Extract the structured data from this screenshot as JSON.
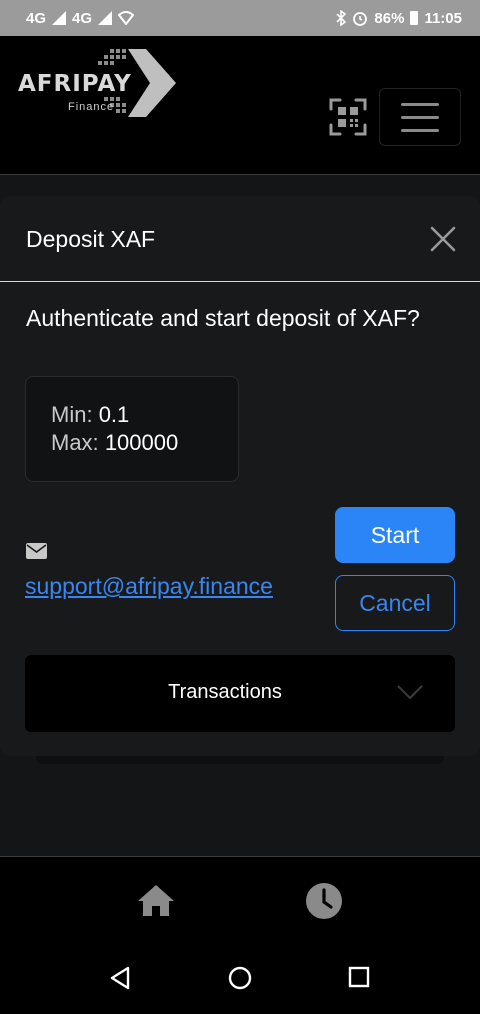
{
  "status_bar": {
    "network_1": "4G",
    "network_2": "4G",
    "battery": "86%",
    "time": "11:05"
  },
  "header": {
    "logo_name": "AFRIPAY",
    "logo_sub": "Finance"
  },
  "modal": {
    "title": "Deposit XAF",
    "question": "Authenticate and start deposit of XAF?",
    "min_label": "Min:",
    "min_value": "0.1",
    "max_label": "Max:",
    "max_value": "100000",
    "support_email": "support@afripay.finance",
    "start_label": "Start",
    "cancel_label": "Cancel",
    "transactions_label": "Transactions"
  },
  "colors": {
    "accent": "#2b85f7",
    "link": "#3a86f0",
    "background": "#141517"
  },
  "icons": [
    "signal-icon",
    "wifi-icon",
    "bluetooth-icon",
    "alarm-icon",
    "battery-icon",
    "qr-code-icon",
    "hamburger-menu-icon",
    "close-icon",
    "envelope-icon",
    "chevron-down-icon",
    "home-icon",
    "clock-icon",
    "nav-back-icon",
    "nav-home-icon",
    "nav-recent-icon"
  ]
}
